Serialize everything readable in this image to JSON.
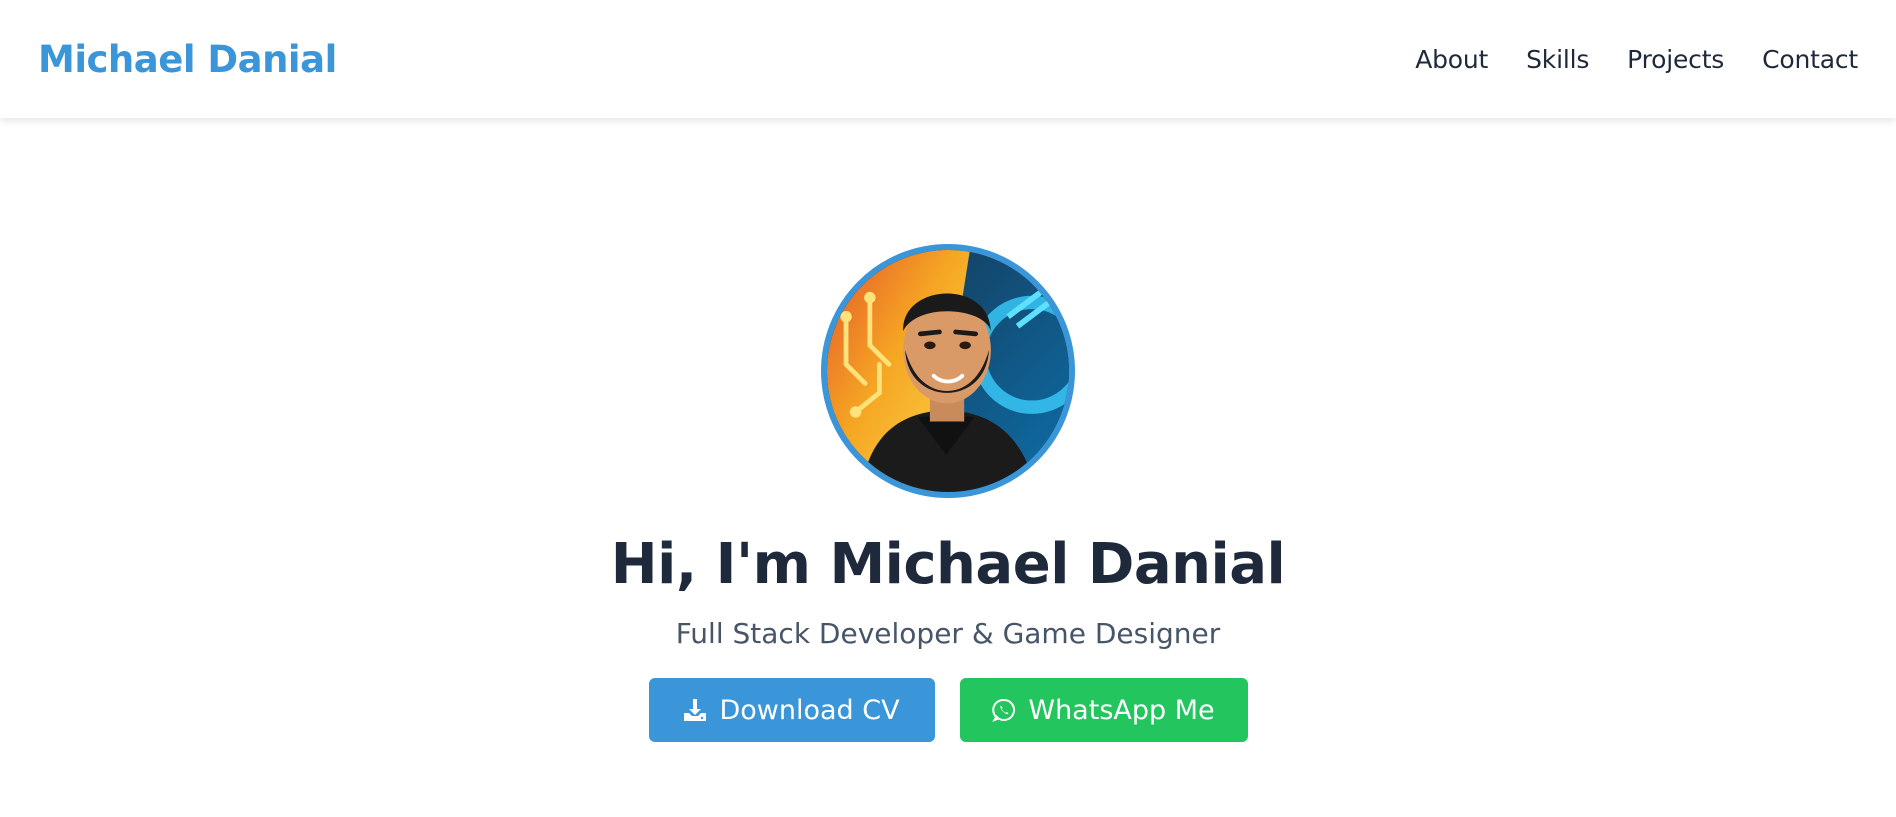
{
  "header": {
    "brand": "Michael Danial",
    "nav": [
      {
        "label": "About"
      },
      {
        "label": "Skills"
      },
      {
        "label": "Projects"
      },
      {
        "label": "Contact"
      }
    ]
  },
  "hero": {
    "avatar_icon": "profile-avatar",
    "title": "Hi, I'm Michael Danial",
    "subtitle": "Full Stack Developer & Game Designer",
    "buttons": {
      "download": {
        "label": "Download CV",
        "icon": "download-icon"
      },
      "whatsapp": {
        "label": "WhatsApp Me",
        "icon": "whatsapp-icon"
      }
    }
  },
  "colors": {
    "accent": "#3a96d8",
    "whatsapp": "#22c55e",
    "heading": "#1e293b",
    "subtitle": "#475569"
  }
}
